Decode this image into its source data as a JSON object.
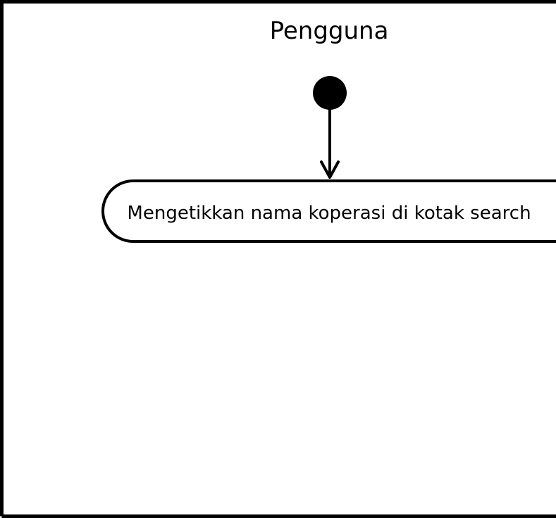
{
  "swimlane": {
    "title": "Pengguna"
  },
  "activity": {
    "action_label": "Mengetikkan nama koperasi di kotak search"
  },
  "colors": {
    "stroke": "#000000",
    "background": "#ffffff"
  }
}
